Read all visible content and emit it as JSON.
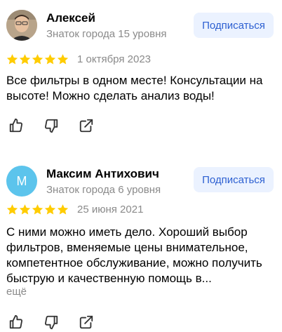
{
  "reviews": [
    {
      "author": "Алексей",
      "level": "Знаток города 15 уровня",
      "subscribe_label": "Подписаться",
      "rating": 5,
      "date": "1 октября 2023",
      "text": "Все фильтры в одном месте! Консультации на высоте! Можно сделать анализ воды!",
      "avatar_type": "photo"
    },
    {
      "author": "Максим Антихович",
      "level": "Знаток города 6 уровня",
      "subscribe_label": "Подписаться",
      "rating": 5,
      "date": "25 июня 2021",
      "text": "С ними можно иметь дело. Хороший выбор фильтров, вменяемые цены внимательное, компетентное обслуживание, можно получить быструю и качественную помощь в...",
      "more_label": "ещё",
      "avatar_letter": "М",
      "avatar_type": "letter"
    }
  ],
  "colors": {
    "star": "#fc0",
    "subscribe_bg": "#ebf2ff",
    "subscribe_text": "#2c5fd1",
    "muted": "#8a8a8a",
    "avatar_letter_bg": "#5cc4ec"
  },
  "icons": [
    "like-icon",
    "dislike-icon",
    "share-icon",
    "star-icon"
  ]
}
